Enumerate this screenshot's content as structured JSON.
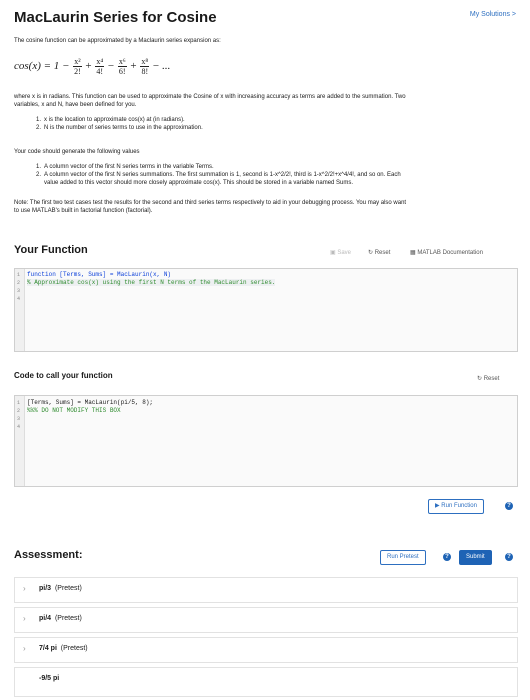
{
  "header": {
    "title": "MacLaurin Series for Cosine",
    "my_solutions": "My Solutions >"
  },
  "intro": "The cosine function can be approximated by a Maclaurin series expansion as:",
  "formula": {
    "lhs": "cos(x) = 1 −",
    "t1_num": "x²",
    "t1_den": "2!",
    "t2_num": "x⁴",
    "t2_den": "4!",
    "t3_num": "x⁶",
    "t3_den": "6!",
    "t4_num": "x⁸",
    "t4_den": "8!",
    "ops": [
      "+",
      "−",
      "+",
      "− ..."
    ]
  },
  "desc1_l1": "where x is in radians. This function can be used to approximate the Cosine of x with increasing accuracy as terms are added to the summation. Two",
  "desc1_l2": "variables, x and N, have been defined for you.",
  "vars": [
    "x is the location to approximate cos(x) at (in radians).",
    "N is the number of series terms to use in the approximation."
  ],
  "desc2": "Your code should generate the following values",
  "values": [
    "A column vector of the first N series terms in the variable Terms.",
    "A column vector of the first N series summations. The first summation is 1, second is 1-x^2/2!, third is 1-x^2/2!+x^4/4!, and so on. Each",
    "value added to this vector should more closely approximate cos(x). This should be stored in a variable named Sums."
  ],
  "note_l1": "Note: The first two test cases test the results for the second and third series terms respectively to aid in your debugging process. You may also want",
  "note_l2": "to use MATLAB's built in factorial function (factorial).",
  "your_function": {
    "heading": "Your Function",
    "save": "Save",
    "reset": "Reset",
    "docs": "MATLAB Documentation",
    "lines": [
      "function [Terms, Sums] = MacLaurin(x, N)",
      "% Approximate cos(x) using the first N terms of the MacLaurin series.",
      "",
      ""
    ],
    "line_numbers": [
      "1",
      "2",
      "3",
      "4"
    ]
  },
  "call_function": {
    "heading": "Code to call your function",
    "reset": "Reset",
    "lines": [
      "[Terms, Sums] = MacLaurin(pi/5, 8);",
      "%%% DO NOT MODIFY THIS BOX",
      "",
      ""
    ],
    "line_numbers": [
      "1",
      "2",
      "3",
      "4"
    ]
  },
  "run_function": "Run Function",
  "assessment": {
    "heading": "Assessment:",
    "run_pretest": "Run Pretest",
    "submit": "Submit",
    "items": [
      {
        "name": "pi/3",
        "tag": "(Pretest)"
      },
      {
        "name": "pi/4",
        "tag": "(Pretest)"
      },
      {
        "name": "7/4 pi",
        "tag": "(Pretest)"
      },
      {
        "name": "-9/5 pi",
        "tag": ""
      }
    ]
  },
  "colors": {
    "accent": "#1e63b5",
    "link": "#2d6fc0",
    "comment": "#2e8b2e",
    "keyword": "#0b3fd9"
  },
  "icons": [
    "reset-icon",
    "book-icon",
    "save-icon",
    "play-icon",
    "help-icon",
    "chevron-right-icon"
  ]
}
